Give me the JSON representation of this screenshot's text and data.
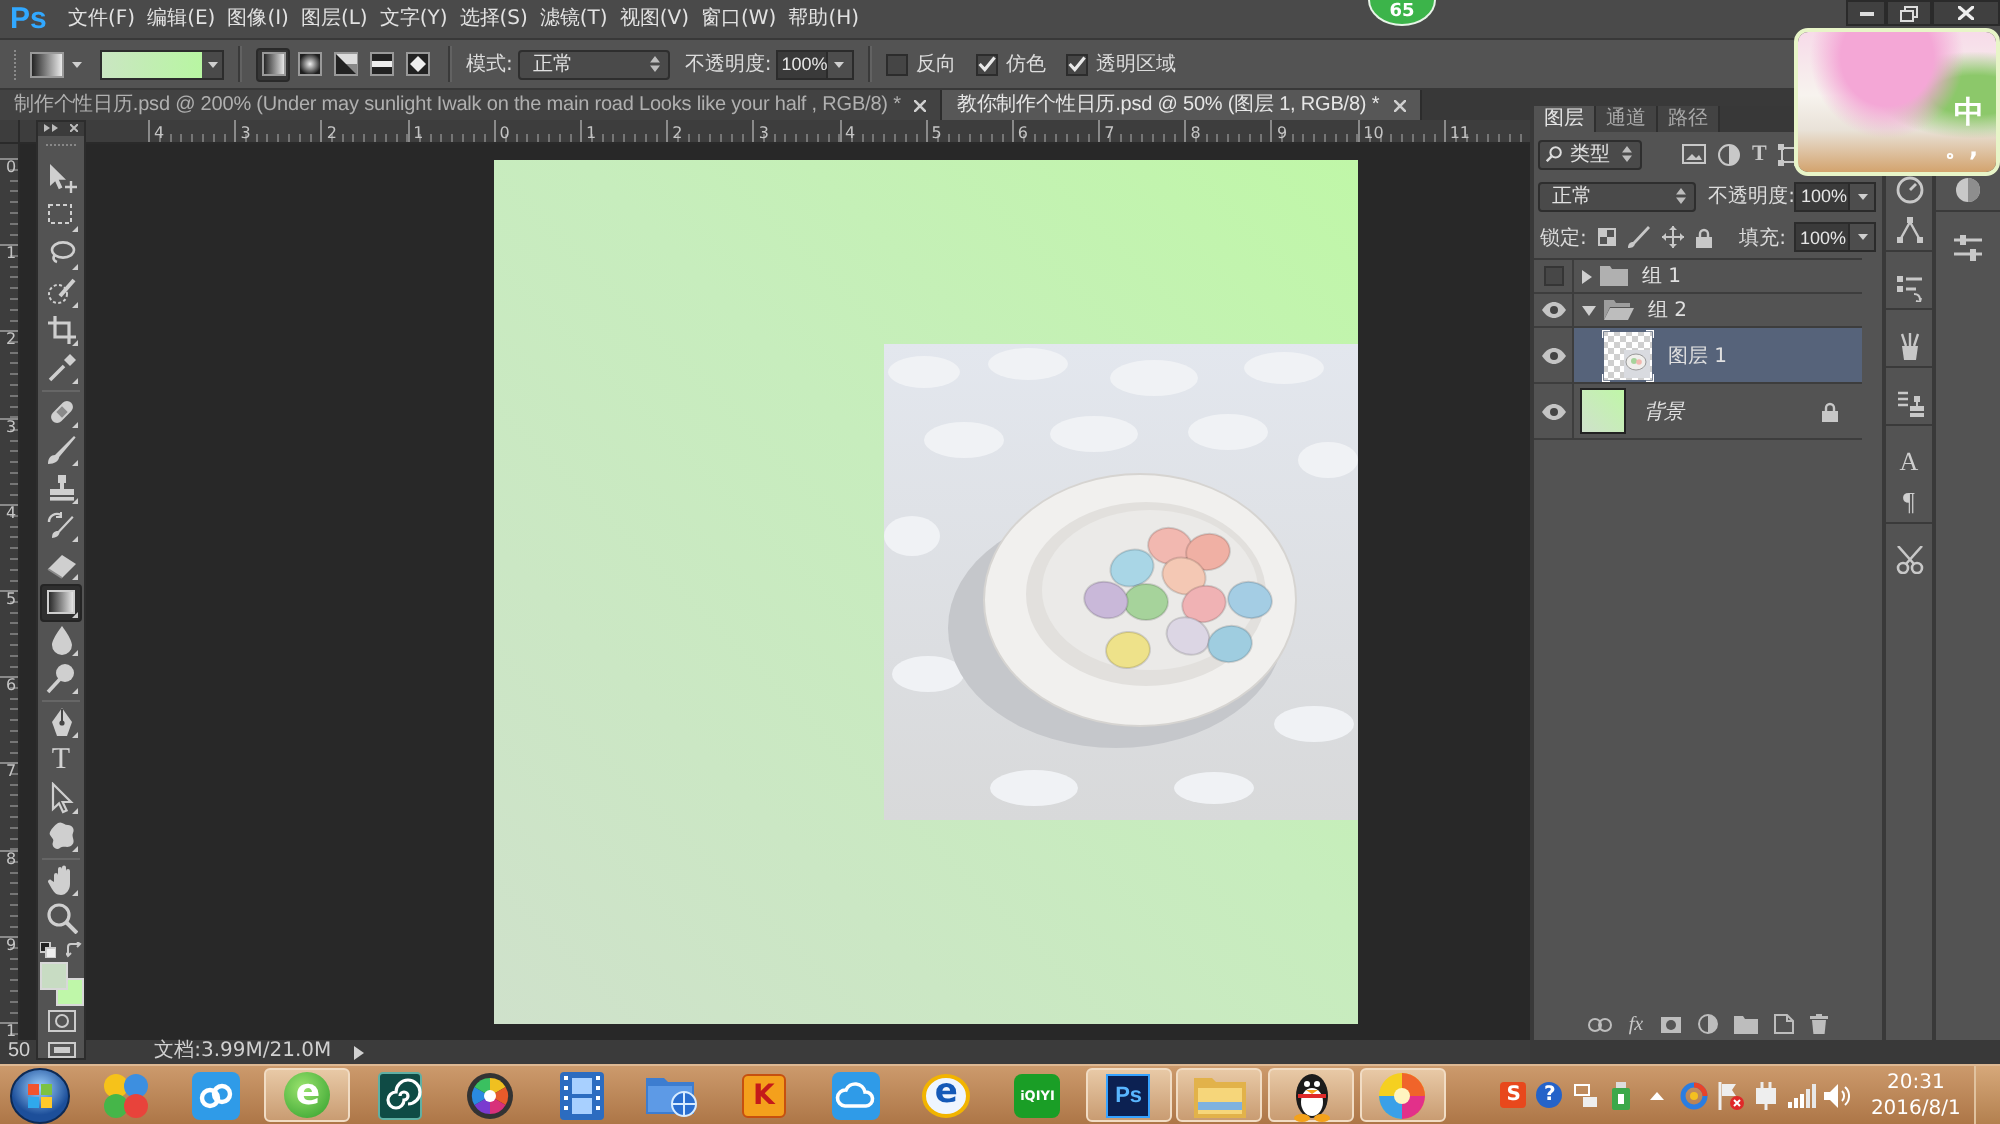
{
  "app": {
    "logo": "Ps",
    "badge": "65"
  },
  "menu": [
    "文件(F)",
    "编辑(E)",
    "图像(I)",
    "图层(L)",
    "文字(Y)",
    "选择(S)",
    "滤镜(T)",
    "视图(V)",
    "窗口(W)",
    "帮助(H)"
  ],
  "options_bar": {
    "gradient_types": [
      {
        "kind": "linear",
        "selected": true
      },
      {
        "kind": "radial",
        "selected": false
      },
      {
        "kind": "angle",
        "selected": false
      },
      {
        "kind": "reflected",
        "selected": false
      },
      {
        "kind": "diamond",
        "selected": false
      }
    ],
    "mode_label": "模式:",
    "mode": "正常",
    "opacity_label": "不透明度:",
    "opacity": "100%",
    "checkboxes": [
      {
        "label": "反向",
        "checked": false
      },
      {
        "label": "仿色",
        "checked": true
      },
      {
        "label": "透明区域",
        "checked": true
      }
    ]
  },
  "document_tabs": [
    {
      "title": "制作个性日历.psd @ 200% (Under may sunlight Iwalk on the main road Looks like your half , RGB/8) *",
      "selected": false
    },
    {
      "title": "教你制作个性日历.psd @ 50% (图层 1, RGB/8) *",
      "selected": true
    }
  ],
  "rulers": {
    "horizontal": [
      "4",
      "3",
      "2",
      "1",
      "0",
      "1",
      "2",
      "3",
      "4",
      "5",
      "6",
      "7",
      "8",
      "9",
      "10",
      "11"
    ],
    "vertical": [
      "0",
      "1",
      "2",
      "3",
      "4",
      "5",
      "6",
      "7",
      "8",
      "9",
      "1"
    ]
  },
  "tools": [
    [
      {
        "kind": "move",
        "selected": false
      },
      {
        "kind": "marquee",
        "selected": false
      },
      {
        "kind": "lasso",
        "selected": false
      },
      {
        "kind": "quick_select",
        "selected": false
      },
      {
        "kind": "crop",
        "selected": false
      },
      {
        "kind": "eyedropper",
        "selected": false
      }
    ],
    [
      {
        "kind": "healing",
        "selected": false
      },
      {
        "kind": "brush",
        "selected": false
      },
      {
        "kind": "stamp",
        "selected": false
      },
      {
        "kind": "history_brush",
        "selected": false
      },
      {
        "kind": "eraser",
        "selected": false
      },
      {
        "kind": "gradient",
        "selected": true
      },
      {
        "kind": "blur",
        "selected": false
      },
      {
        "kind": "dodge",
        "selected": false
      }
    ],
    [
      {
        "kind": "pen",
        "selected": false
      },
      {
        "kind": "type",
        "glyph": "T",
        "selected": false
      },
      {
        "kind": "path_select",
        "selected": false
      },
      {
        "kind": "shape",
        "selected": false
      }
    ],
    [
      {
        "kind": "hand",
        "selected": false
      },
      {
        "kind": "zoom",
        "selected": false
      }
    ]
  ],
  "color_swatches": [
    {
      "kind": "foreground",
      "color": "#c8dcc3"
    },
    {
      "kind": "background",
      "color": "#bff7a9"
    }
  ],
  "status_bar": {
    "zoom": "50",
    "document_size": "文档:3.99M/21.0M"
  },
  "layers_panel": {
    "tabs": [
      {
        "label": "图层",
        "selected": true
      },
      {
        "label": "通道",
        "selected": false
      },
      {
        "label": "路径",
        "selected": false
      }
    ],
    "filter": "类型",
    "filter_buttons": [
      {
        "kind": "pixel"
      },
      {
        "kind": "adjustment"
      },
      {
        "kind": "type",
        "glyph": "T"
      },
      {
        "kind": "shape"
      }
    ],
    "blend_mode": "正常",
    "opacity_label": "不透明度:",
    "opacity": "100%",
    "lock_label": "锁定:",
    "fill_label": "填充:",
    "fill": "100%",
    "layers": [
      {
        "kind": "group",
        "name": "组 1",
        "visible": false,
        "expanded": false,
        "selected": false,
        "locked": false
      },
      {
        "kind": "group",
        "name": "组 2",
        "visible": true,
        "expanded": true,
        "selected": false,
        "locked": false,
        "children": [
          {
            "kind": "layer",
            "name": "图层 1",
            "visible": true,
            "selected": true,
            "locked": false
          }
        ]
      },
      {
        "kind": "background",
        "name": "背景",
        "visible": true,
        "selected": false,
        "locked": true
      }
    ],
    "footer_buttons": [
      {
        "kind": "link"
      },
      {
        "kind": "effects",
        "glyph": "fx"
      },
      {
        "kind": "mask"
      },
      {
        "kind": "adjustment"
      },
      {
        "kind": "group"
      },
      {
        "kind": "new"
      },
      {
        "kind": "delete"
      }
    ]
  },
  "panel_docks": [
    [
      [
        {
          "kind": "dial"
        },
        {
          "kind": "paths"
        }
      ],
      [
        {
          "kind": "history"
        }
      ],
      [
        {
          "kind": "brush_presets"
        }
      ],
      [
        {
          "kind": "clone_source"
        }
      ],
      [
        {
          "kind": "character",
          "glyph": "A"
        },
        {
          "kind": "paragraph",
          "glyph": "¶"
        }
      ],
      [
        {
          "kind": "tool_presets"
        }
      ]
    ],
    [
      [
        {
          "kind": "styles"
        }
      ],
      [
        {
          "kind": "adjustments"
        }
      ]
    ]
  ],
  "ime": {
    "mode": "中",
    "punctuation": "。,"
  },
  "taskbar": {
    "items": [
      {
        "kind": "four_circles",
        "running": false
      },
      {
        "kind": "link_tile",
        "running": false
      },
      {
        "kind": "browser_360",
        "glyph": "e",
        "running": true
      },
      {
        "kind": "spiral_tile",
        "running": false
      },
      {
        "kind": "aperture",
        "running": false
      },
      {
        "kind": "film",
        "running": false
      },
      {
        "kind": "network_folder",
        "running": false
      },
      {
        "kind": "gift_box",
        "glyph": "K",
        "running": false
      },
      {
        "kind": "cloud_tile",
        "running": false
      },
      {
        "kind": "ie",
        "glyph": "e",
        "running": false
      },
      {
        "kind": "video_tile",
        "glyph": "iQIYI",
        "running": false
      },
      {
        "kind": "ps_tile",
        "glyph": "Ps",
        "running": true
      },
      {
        "kind": "folder",
        "running": true
      },
      {
        "kind": "penguin",
        "running": true
      },
      {
        "kind": "color_ball",
        "running": true
      }
    ],
    "tray": [
      {
        "kind": "input_method",
        "glyph": "S"
      },
      {
        "kind": "help",
        "glyph": "?"
      },
      {
        "kind": "small_window"
      },
      {
        "kind": "usb"
      },
      {
        "kind": "show_hidden"
      },
      {
        "kind": "ring"
      },
      {
        "kind": "flag"
      },
      {
        "kind": "power"
      },
      {
        "kind": "signal"
      },
      {
        "kind": "volume"
      }
    ],
    "time": "20:31",
    "date": "2016/8/1"
  }
}
